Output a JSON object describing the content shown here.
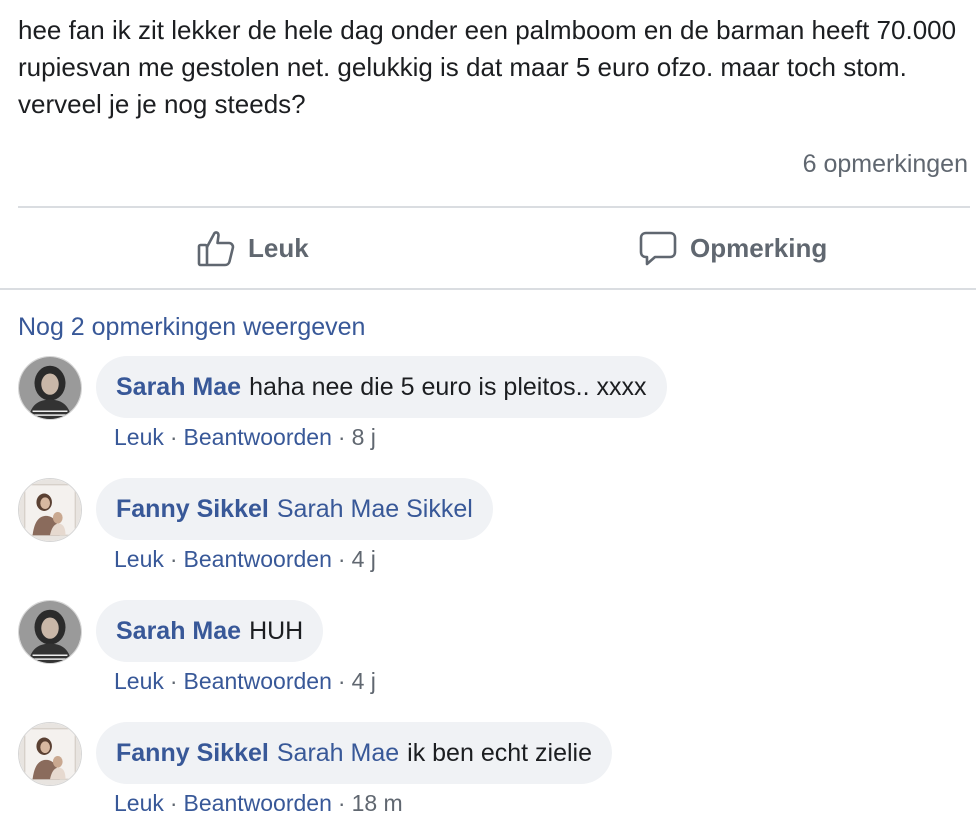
{
  "post": {
    "text": "hee fan ik zit lekker de hele dag onder een palmboom en de barman heeft 70.000 rupiesvan me gestolen net. gelukkig is dat maar 5 euro ofzo. maar toch stom. verveel je je nog steeds?",
    "comment_count": "6 opmerkingen"
  },
  "actions": {
    "like_label": "Leuk",
    "comment_label": "Opmerking"
  },
  "more_comments": "Nog 2 opmerkingen weergeven",
  "meta_labels": {
    "like": "Leuk",
    "reply": "Beantwoorden",
    "dot": "·"
  },
  "comments": [
    {
      "author": "Sarah Mae",
      "mention": "",
      "text": "haha nee die 5 euro is pleitos.. xxxx",
      "time": "8 j"
    },
    {
      "author": "Fanny Sikkel",
      "mention": "Sarah Mae Sikkel",
      "text": "",
      "time": "4 j"
    },
    {
      "author": "Sarah Mae",
      "mention": "",
      "text": "HUH",
      "time": "4 j"
    },
    {
      "author": "Fanny Sikkel",
      "mention": "Sarah Mae",
      "text": "ik ben echt zielie",
      "time": "18 m"
    }
  ],
  "colors": {
    "link": "#385898",
    "bubble": "#f0f2f5",
    "muted": "#606770",
    "divider": "#dadde1"
  },
  "icons": {
    "like": "thumbs-up-icon",
    "comment": "speech-bubble-icon"
  }
}
